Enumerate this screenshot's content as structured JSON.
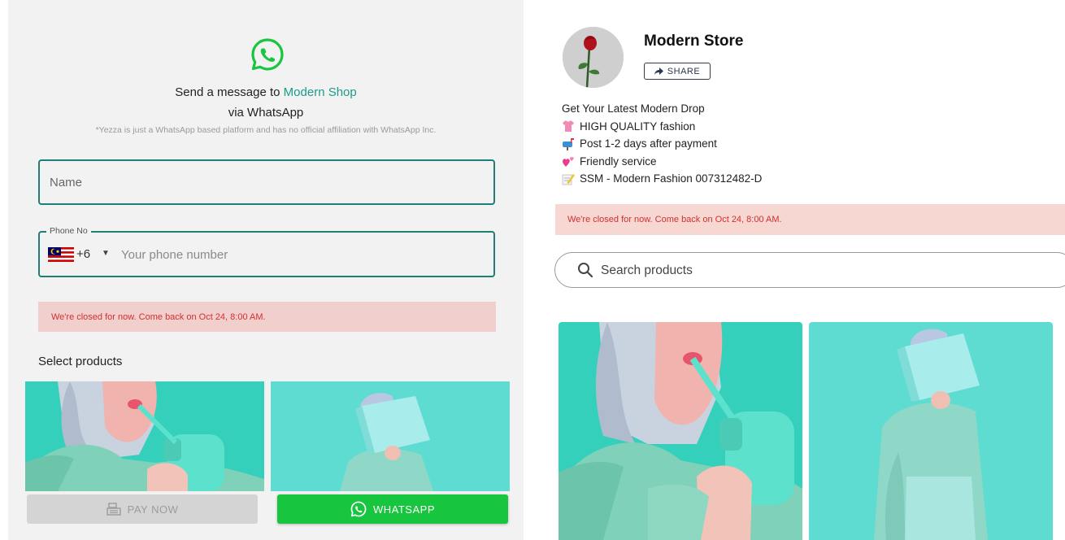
{
  "left_panel": {
    "send_prefix": "Send a message to ",
    "shop_name": "Modern Shop",
    "via_text": "via WhatsApp",
    "disclaimer": "*Yezza is just a WhatsApp based platform and has no official affiliation with WhatsApp Inc.",
    "name_field": {
      "placeholder": "Name"
    },
    "phone_field": {
      "legend": "Phone No",
      "dial_code": "+6",
      "placeholder": "Your phone number",
      "country_flag": "malaysia-flag-icon"
    },
    "closed_notice": "We're closed for now. Come back on Oct 24, 8:00 AM.",
    "select_products_label": "Select products",
    "pay_now_label": "PAY NOW",
    "whatsapp_label": "WHATSAPP"
  },
  "right_panel": {
    "store_name": "Modern Store",
    "share_label": "SHARE",
    "bio": [
      {
        "icon": "shirt-emoji-icon",
        "text": "Get Your Latest Modern Drop"
      },
      {
        "icon": "shirt-emoji-icon",
        "text": "HIGH QUALITY fashion"
      },
      {
        "icon": "mailbox-emoji-icon",
        "text": "Post 1-2 days after payment"
      },
      {
        "icon": "hearts-emoji-icon",
        "text": "Friendly service"
      },
      {
        "icon": "memo-emoji-icon",
        "text": "SSM - Modern Fashion 007312482-D"
      }
    ],
    "closed_notice": "We're closed for now. Come back on Oct 24, 8:00 AM.",
    "search_placeholder": "Search products"
  },
  "colors": {
    "whatsapp_green": "#17c53f",
    "teal_accent": "#1d7f76",
    "closed_text": "#d32f2f",
    "product_bg": "#4fd8c8"
  }
}
